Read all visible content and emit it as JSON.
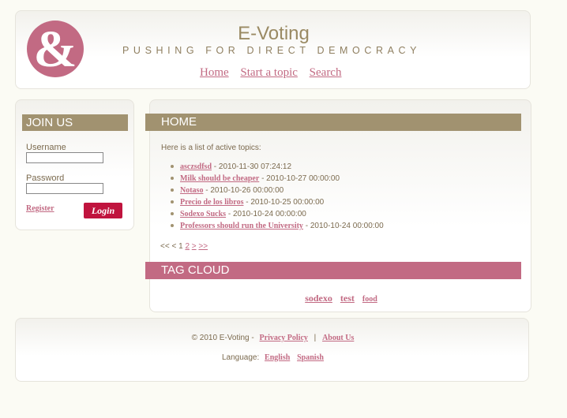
{
  "header": {
    "logo_glyph": "&",
    "title": "E-Voting",
    "tagline": "PUSHING FOR DIRECT DEMOCRACY",
    "nav": [
      "Home",
      "Start a topic",
      "Search"
    ]
  },
  "join": {
    "heading": "JOIN US",
    "username_label": "Username",
    "username_value": "",
    "password_label": "Password",
    "password_value": "",
    "register": "Register",
    "login": "Login"
  },
  "main": {
    "heading": "HOME",
    "intro": "Here is a list of active topics:",
    "topics": [
      {
        "title": "asczsdfsd",
        "date": "- 2010-11-30 07:24:12"
      },
      {
        "title": "Milk should be cheaper",
        "date": "- 2010-10-27 00:00:00"
      },
      {
        "title": "Notaso",
        "date": "- 2010-10-26 00:00:00"
      },
      {
        "title": "Precio de los libros",
        "date": "- 2010-10-25 00:00:00"
      },
      {
        "title": "Sodexo Sucks",
        "date": "- 2010-10-24 00:00:00"
      },
      {
        "title": "Professors should run the University",
        "date": "- 2010-10-24 00:00:00"
      }
    ],
    "pager": {
      "first": "<<",
      "prev": "<",
      "current": "1",
      "page2": "2",
      "next": ">",
      "last": ">>"
    },
    "tag_heading": "TAG CLOUD",
    "tags": [
      "sodexo",
      "test",
      "food"
    ]
  },
  "footer": {
    "copyright": "© 2010 E-Voting -",
    "privacy": "Privacy Policy",
    "separator": "|",
    "about": "About Us",
    "language_label": "Language:",
    "languages": [
      "English",
      "Spanish"
    ]
  },
  "colors": {
    "accent_pink": "#c26a83",
    "tan": "#a19270",
    "login_red": "#c0143e"
  }
}
